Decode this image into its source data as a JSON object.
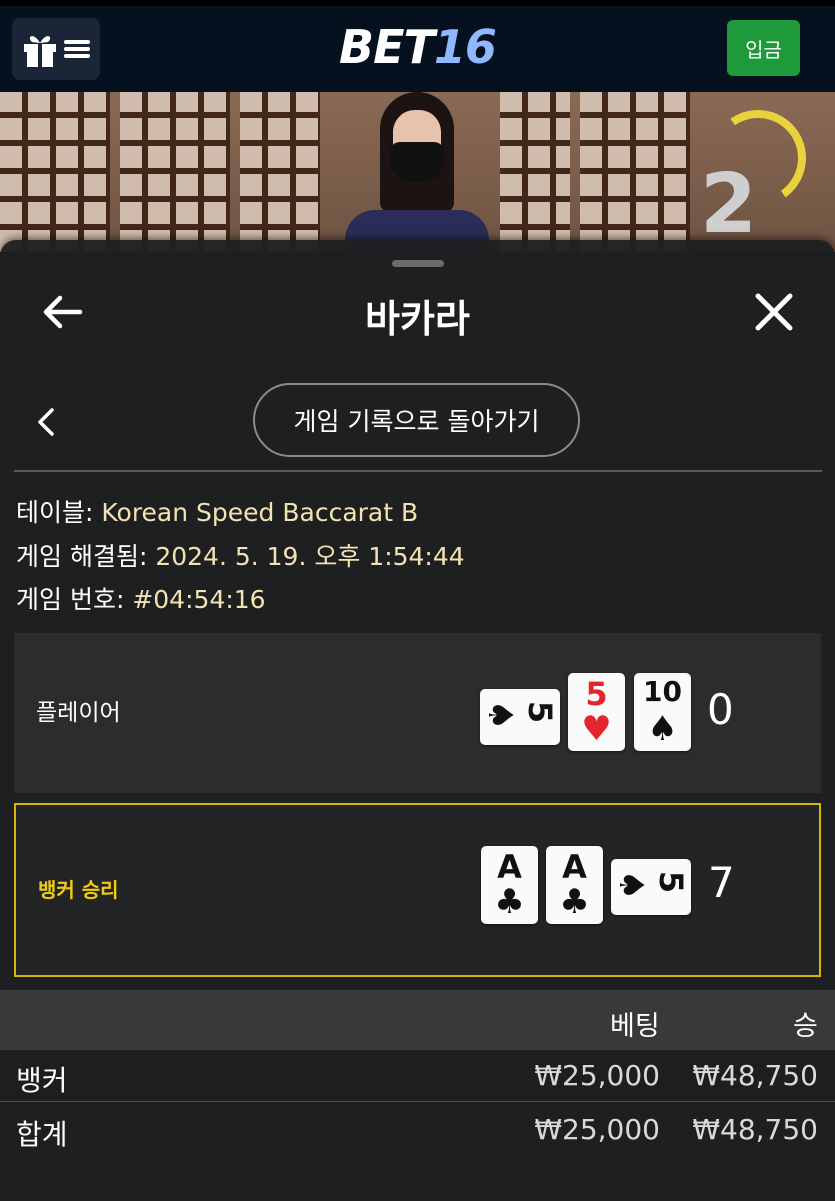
{
  "header": {
    "logo_part1": "BET",
    "logo_part2": "16",
    "deposit_label": "입금",
    "menu_icons": [
      "gift-icon",
      "hamburger-icon"
    ]
  },
  "video": {
    "timer_value": "2"
  },
  "sheet": {
    "title": "바카라",
    "back_to_history_label": "게임 기록으로 돌아가기"
  },
  "info": {
    "table_key": "테이블: ",
    "table_value": "Korean Speed Baccarat B",
    "resolved_key": "게임 해결됨: ",
    "resolved_value": "2024. 5. 19. 오후 1:54:44",
    "number_key": "게임 번호: ",
    "number_value": "#04:54:16"
  },
  "player": {
    "label": "플레이어",
    "score": "0",
    "cards": [
      {
        "rank": "5",
        "suit": "♠",
        "color": "black",
        "rotated": true
      },
      {
        "rank": "5",
        "suit": "♥",
        "color": "red",
        "rotated": false
      },
      {
        "rank": "10",
        "suit": "♠",
        "color": "black",
        "rotated": false
      }
    ]
  },
  "banker": {
    "label": "뱅커 승리",
    "score": "7",
    "cards": [
      {
        "rank": "A",
        "suit": "♣",
        "color": "black",
        "rotated": false
      },
      {
        "rank": "A",
        "suit": "♣",
        "color": "black",
        "rotated": false
      },
      {
        "rank": "5",
        "suit": "♠",
        "color": "black",
        "rotated": true
      }
    ]
  },
  "bets": {
    "col_bet": "베팅",
    "col_win": "승",
    "rows": [
      {
        "name": "뱅커",
        "bet": "₩25,000",
        "win": "₩48,750"
      },
      {
        "name": "합계",
        "bet": "₩25,000",
        "win": "₩48,750"
      }
    ]
  },
  "colors": {
    "accent_green": "#1e9a3a",
    "banker_highlight": "#d8b500",
    "info_value": "#f2e3b3"
  }
}
